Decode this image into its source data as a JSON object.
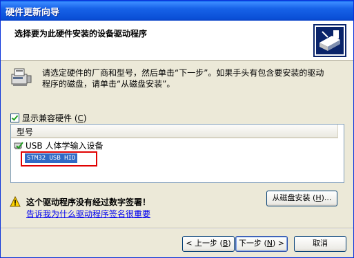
{
  "window": {
    "title": "硬件更新向导"
  },
  "header": {
    "title": "选择要为此硬件安装的设备驱动程序",
    "icon": "hardware-wizard-icon"
  },
  "info": {
    "line1": "请选定硬件的厂商和型号，然后单击“下一步”。如果手头有包含要安装的驱动",
    "line2": "程序的磁盘，请单击“从磁盘安装”。",
    "icon": "hardware-device-icon"
  },
  "compat": {
    "label_main": "显示兼容硬件 (",
    "label_key": "C",
    "label_end": ")",
    "checked": true
  },
  "list": {
    "column_header": "型号",
    "items": [
      {
        "label": "USB 人体学输入设备",
        "icon": "hid-device-icon",
        "selected": false
      },
      {
        "label": "STM32 USB HID",
        "selected": true
      }
    ]
  },
  "warning": {
    "text": "这个驱动程序没有经过数字签署！",
    "link": "告诉我为什么驱动程序签名很重要",
    "icon": "warning-icon"
  },
  "buttons": {
    "have_disk": {
      "main": "从磁盘安装 (",
      "key": "H",
      "end": ")..."
    },
    "back": {
      "main": "< 上一步 (",
      "key": "B",
      "end": ")"
    },
    "next": {
      "main": "下一步 (",
      "key": "N",
      "end": ") >"
    },
    "cancel": "取消"
  },
  "colors": {
    "title_bar": "#0a5fe8",
    "dialog_bg": "#ece9d8",
    "selection": "#316ac5",
    "highlight_box": "#e00000",
    "link": "#0000ee"
  }
}
